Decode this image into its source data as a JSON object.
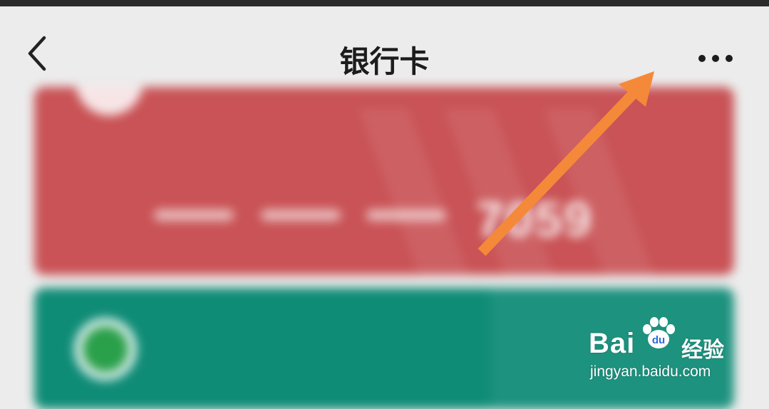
{
  "header": {
    "title": "银行卡",
    "back_icon": "chevron-left-icon",
    "more_icon": "more-horizontal-icon"
  },
  "cards": [
    {
      "color": "#c95356",
      "card_tail": "7059"
    },
    {
      "color": "#0f8c76"
    }
  ],
  "annotation": {
    "color": "#f5893a",
    "icon": "arrow-up-right-icon"
  },
  "watermark": {
    "brand": "Bai",
    "brand_suffix": "经验",
    "url": "jingyan.baidu.com"
  }
}
